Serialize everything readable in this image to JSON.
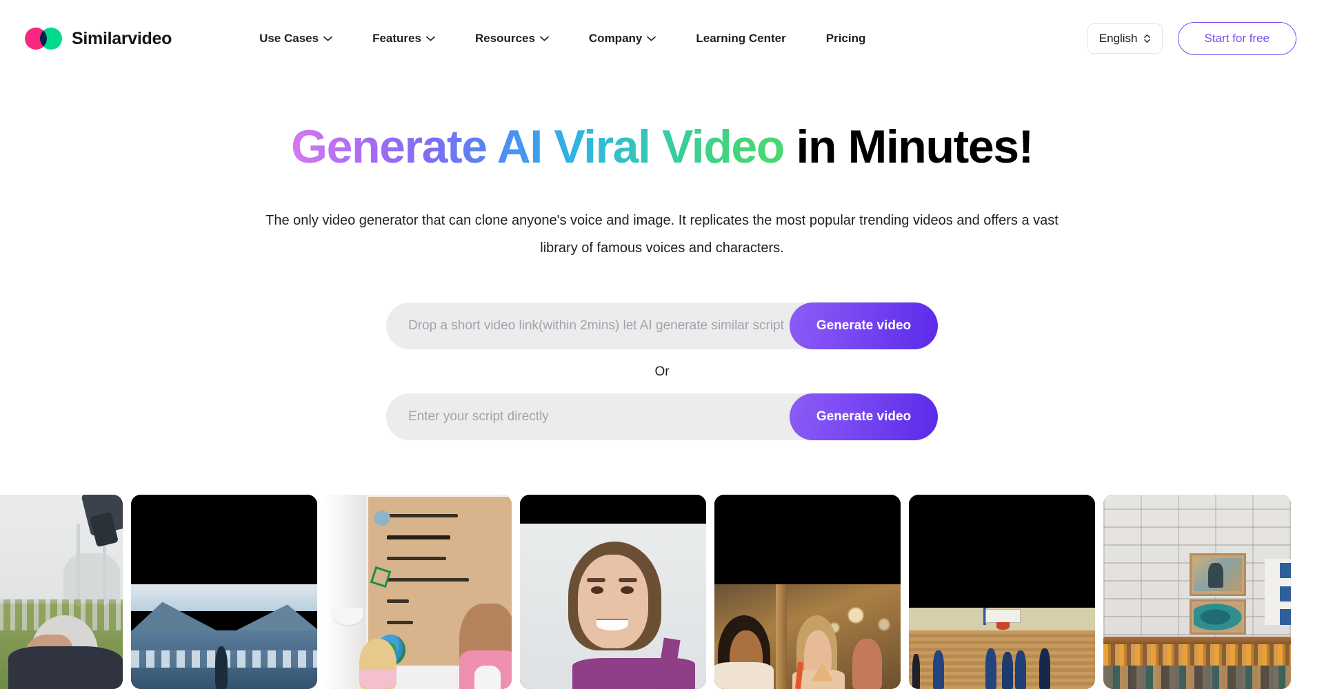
{
  "brand": {
    "name": "Similarvideo",
    "logo_left_color": "#f8277f",
    "logo_right_color": "#02d98c"
  },
  "nav": {
    "items": [
      {
        "label": "Use Cases",
        "has_dropdown": true
      },
      {
        "label": "Features",
        "has_dropdown": true
      },
      {
        "label": "Resources",
        "has_dropdown": true
      },
      {
        "label": "Company",
        "has_dropdown": true
      },
      {
        "label": "Learning Center",
        "has_dropdown": false
      },
      {
        "label": "Pricing",
        "has_dropdown": false
      }
    ]
  },
  "header_right": {
    "language": "English",
    "cta_label": "Start for free",
    "cta_color": "#7b4bf0"
  },
  "hero": {
    "headline_gradient": "Generate AI Viral Video",
    "headline_plain": " in Minutes!",
    "subheading": "The only video generator that can clone anyone's voice and image. It replicates the most popular trending videos and offers a vast library of famous voices and characters."
  },
  "forms": {
    "link_input": {
      "placeholder": "Drop a short video link(within 2mins) let AI generate similar script",
      "value": "",
      "button_label": "Generate video"
    },
    "divider_label": "Or",
    "script_input": {
      "placeholder": "Enter your script directly",
      "value": "",
      "button_label": "Generate video"
    },
    "button_gradient_from": "#8c5cf5",
    "button_gradient_to": "#5a2ae9",
    "field_background": "#ececec"
  },
  "gallery": {
    "items": [
      {
        "name": "elderly-man-cemetery-mosque"
      },
      {
        "name": "arctic-whale-letterbox"
      },
      {
        "name": "recycling-poster-rethink-refuse"
      },
      {
        "name": "smiling-woman-portrait"
      },
      {
        "name": "two-women-eating-restaurant"
      },
      {
        "name": "basketball-gym-players"
      },
      {
        "name": "clothing-store-brick-wall"
      }
    ]
  }
}
